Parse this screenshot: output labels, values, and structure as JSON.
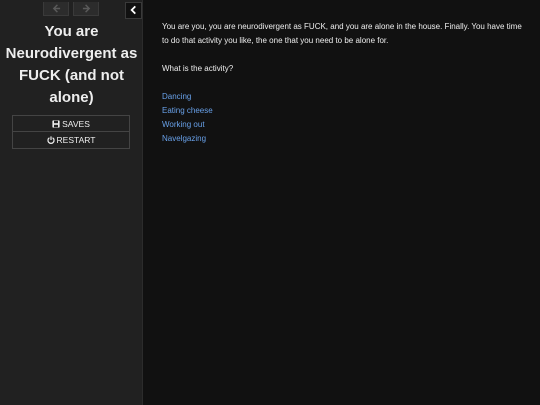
{
  "sidebar": {
    "title": "You are Neurodivergent as FUCK (and not alone)",
    "menu": [
      {
        "label": "SAVES",
        "icon": "floppy-disk-icon"
      },
      {
        "label": "RESTART",
        "icon": "power-icon"
      }
    ],
    "history_back_icon": "arrow-left-icon",
    "history_forward_icon": "arrow-right-icon",
    "collapse_icon": "chevron-left-icon"
  },
  "passage": {
    "intro": "You are you, you are neurodivergent as FUCK, and you are alone in the house. Finally. You have time to do that activity you like, the one that you need to be alone for.",
    "question": "What is the activity?",
    "choices": [
      "Dancing",
      "Eating cheese",
      "Working out",
      "Navelgazing"
    ]
  },
  "colors": {
    "background": "#111111",
    "sidebar": "#212121",
    "text": "#eeeeee",
    "link": "#68a0e8"
  }
}
